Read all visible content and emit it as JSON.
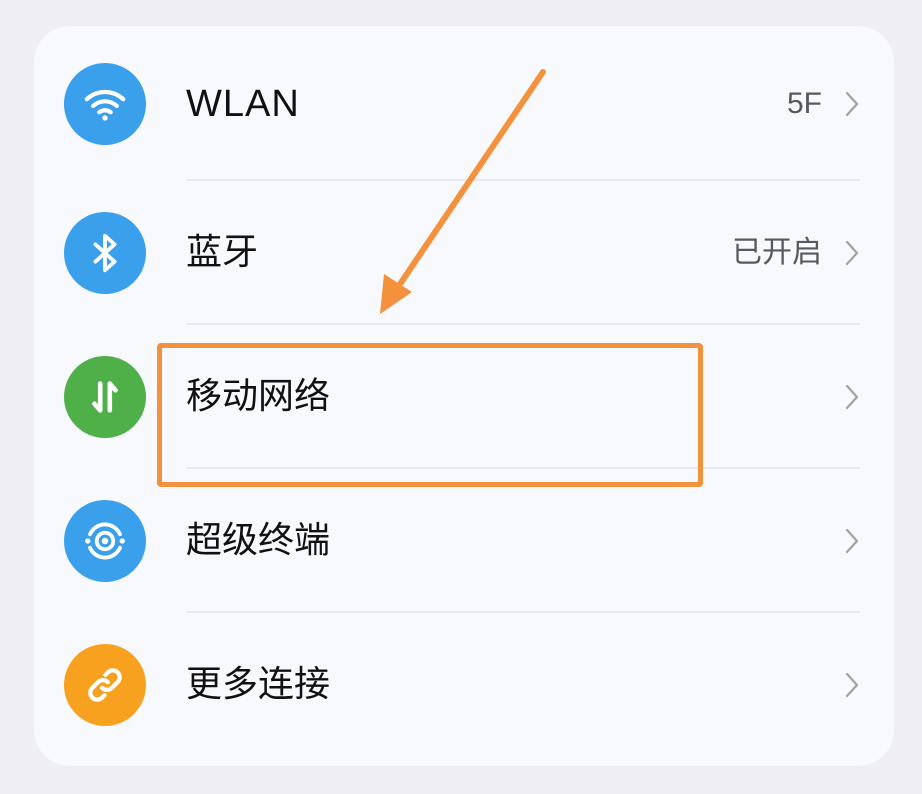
{
  "settings_list": {
    "items": [
      {
        "icon": "wifi-icon",
        "icon_color": "#3aa0ec",
        "label": "WLAN",
        "value": "5F"
      },
      {
        "icon": "bluetooth-icon",
        "icon_color": "#3aa0ec",
        "label": "蓝牙",
        "value": "已开启"
      },
      {
        "icon": "mobile-data-icon",
        "icon_color": "#4fb04a",
        "label": "移动网络",
        "value": "",
        "highlighted": true
      },
      {
        "icon": "super-device-icon",
        "icon_color": "#3aa0ec",
        "label": "超级终端",
        "value": ""
      },
      {
        "icon": "link-icon",
        "icon_color": "#f7a11e",
        "label": "更多连接",
        "value": ""
      }
    ]
  },
  "annotation": {
    "highlight_color": "#f3913d",
    "target": "移动网络"
  }
}
